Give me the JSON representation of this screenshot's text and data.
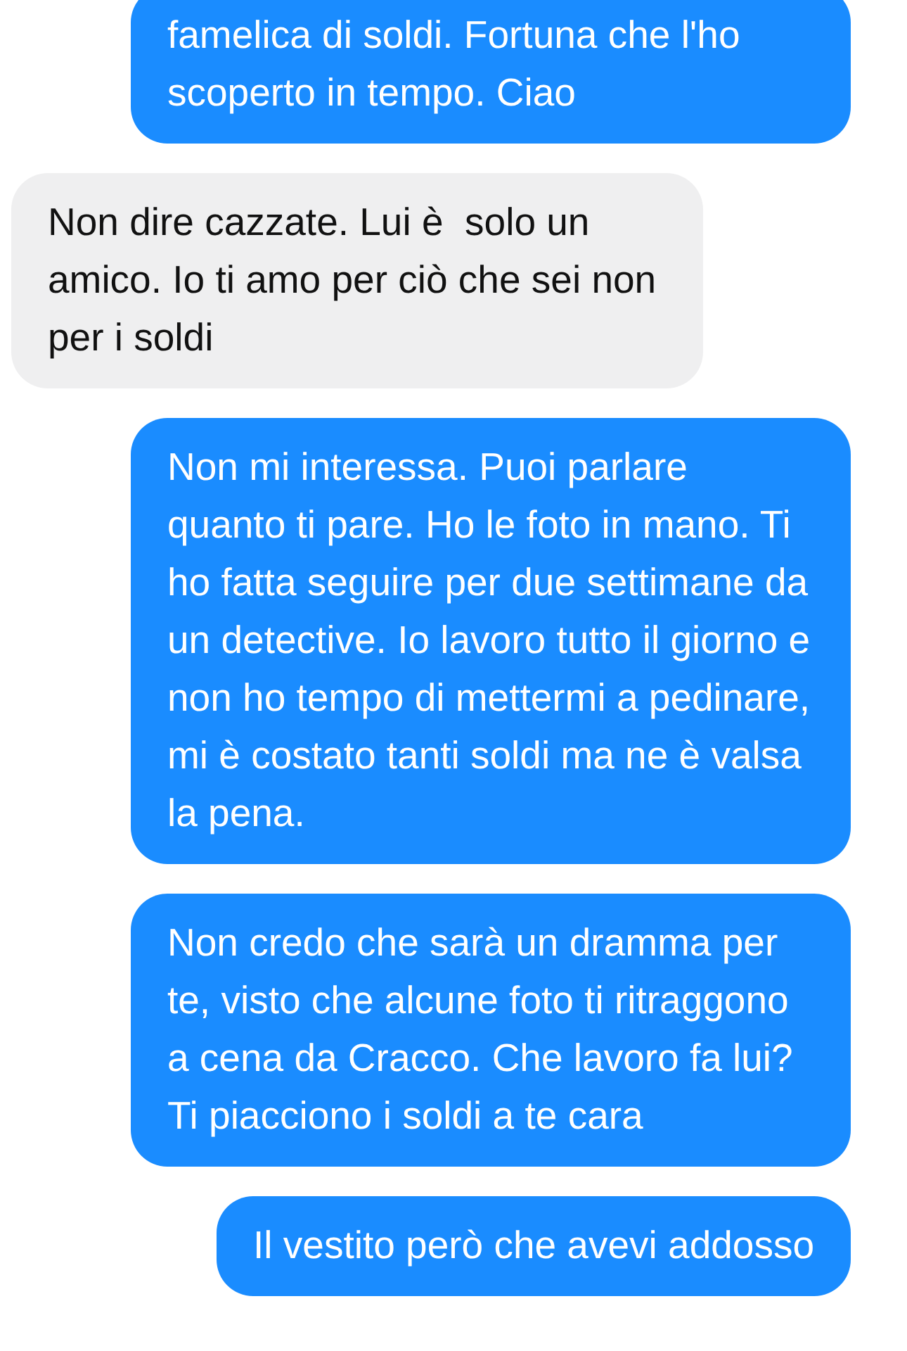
{
  "messages": [
    {
      "kind": "sent",
      "text": "famelica di soldi. Fortuna che l'ho scoperto in tempo. Ciao"
    },
    {
      "kind": "received",
      "text": "Non dire cazzate. Lui è  solo un amico. Io ti amo per ciò che sei non per i soldi"
    },
    {
      "kind": "sent",
      "text": "Non mi interessa. Puoi parlare quanto ti pare. Ho le foto in mano. Ti ho fatta seguire per due settimane da un detective. Io lavoro tutto il giorno e non ho tempo di mettermi a pedinare, mi è costato tanti soldi ma ne è valsa la pena."
    },
    {
      "kind": "sent",
      "text": "Non credo che sarà un dramma per te, visto che alcune foto ti ritraggono a cena da Cracco. Che lavoro fa lui? Ti piacciono i soldi a te cara"
    },
    {
      "kind": "sent",
      "text": "Il vestito però che avevi addosso"
    }
  ]
}
